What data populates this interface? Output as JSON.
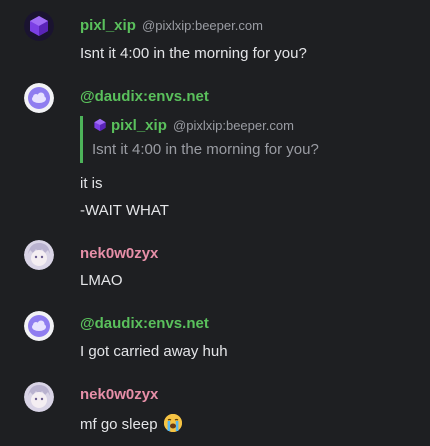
{
  "colors": {
    "background": "#1e1f22",
    "name_green": "#5ac05c",
    "name_pink": "#e78fa8",
    "muted": "#9a9ca3",
    "quote_bar": "#4db35a"
  },
  "messages": [
    {
      "name": "pixl_xip",
      "handle": "@pixlxip:beeper.com",
      "lines": [
        "Isnt it 4:00 in the morning for you?"
      ],
      "avatar_icon": "purple-cube-icon"
    },
    {
      "name": "@daudix:envs.net",
      "quote": {
        "name": "pixl_xip",
        "handle": "@pixlxip:beeper.com",
        "text": "Isnt it 4:00 in the morning for you?"
      },
      "lines": [
        "it is",
        "-WAIT WHAT"
      ],
      "avatar_icon": "cloud-avatar-icon"
    },
    {
      "name": "nek0w0zyx",
      "lines": [
        "LMAO"
      ],
      "avatar_icon": "anime-avatar-icon"
    },
    {
      "name": "@daudix:envs.net",
      "lines": [
        "I got carried away huh"
      ],
      "avatar_icon": "cloud-avatar-icon"
    },
    {
      "name": "nek0w0zyx",
      "lines": [
        "mf go sleep"
      ],
      "emoji": "loudly-crying-face-emoji",
      "avatar_icon": "anime-avatar-icon"
    }
  ]
}
